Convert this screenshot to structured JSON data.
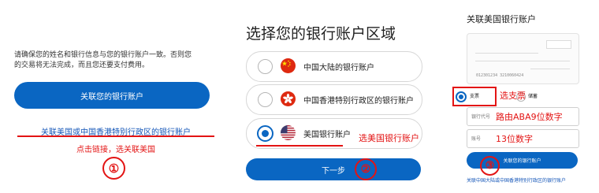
{
  "panel1": {
    "notice_line1": "请确保您的姓名和银行信息与您的银行账户一致。否则您",
    "notice_line2": "的交易将无法完成，而且您还要支付费用。",
    "link_bank_button": "关联您的银行账户",
    "us_hk_link": "关联美国或中国香港特别行政区的银行账户",
    "annotation_caption": "点击链接，选关联美国",
    "annotation_step": "①"
  },
  "panel2": {
    "title": "选择您的银行账户区域",
    "options": [
      {
        "label": "中国大陆的银行账户",
        "flag": "china-flag-icon",
        "selected": false
      },
      {
        "label": "中国香港特别行政区的银行账户",
        "flag": "hong-kong-flag-icon",
        "selected": false
      },
      {
        "label": "美国银行账户",
        "flag": "us-flag-icon",
        "selected": true
      }
    ],
    "next_button": "下一步",
    "annotation_caption": "选美国银行账户",
    "annotation_step": "②"
  },
  "panel3": {
    "title": "关联美国银行账户",
    "cheque_numbers": "012301234    3210060424",
    "account_types": {
      "checking": "支票",
      "savings": "储蓄",
      "selected": "checking"
    },
    "annotation_checking": "选支票",
    "routing_placeholder": "银行代号",
    "routing_annotation": "路由ABA9位数字",
    "account_placeholder": "账号",
    "account_annotation": "13位数字",
    "link_button": "关联您的银行账户",
    "footer_link": "关联中国大陆或中国香港特别行政区的银行账户",
    "annotation_step": "③"
  },
  "colors": {
    "primary_blue": "#0a66c2",
    "link_blue": "#1456b8",
    "annotation_red": "#e31414"
  }
}
